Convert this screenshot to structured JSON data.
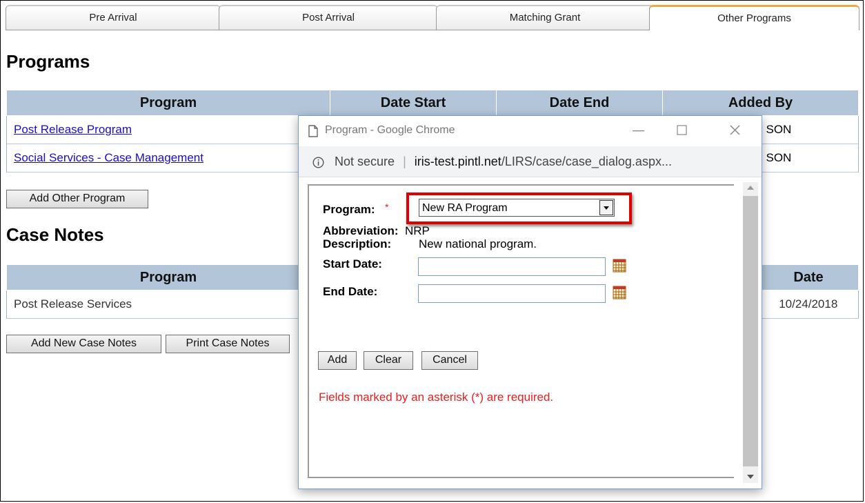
{
  "tabs": [
    "Pre Arrival",
    "Post Arrival",
    "Matching Grant",
    "Other Programs"
  ],
  "programs": {
    "heading": "Programs",
    "columns": [
      "Program",
      "Date Start",
      "Date End",
      "Added By"
    ],
    "rows": [
      {
        "program": "Post Release Program",
        "added_by": "SON"
      },
      {
        "program": "Social Services - Case Management",
        "added_by": "SON"
      }
    ],
    "add_button": "Add Other Program"
  },
  "case_notes": {
    "heading": "Case Notes",
    "columns": [
      "Program",
      "Date"
    ],
    "rows": [
      {
        "program": "Post Release Services",
        "date": "10/24/2018"
      }
    ],
    "add_button": "Add New Case Notes",
    "print_button": "Print Case Notes"
  },
  "popup": {
    "window_title": "Program - Google Chrome",
    "security": "Not secure",
    "url_host": "iris-test.pintl.net",
    "url_path": "/LIRS/case/case_dialog.aspx...",
    "program_label": "Program:",
    "required_mark": "*",
    "program_selected": "New RA Program",
    "abbreviation_label": "Abbreviation:",
    "abbreviation_value": "NRP",
    "description_label": "Description:",
    "description_value": "New national program.",
    "start_date_label": "Start Date:",
    "end_date_label": "End Date:",
    "start_date_value": "",
    "end_date_value": "",
    "add_label": "Add",
    "clear_label": "Clear",
    "cancel_label": "Cancel",
    "required_note": "Fields marked by an asterisk (*) are required."
  },
  "colors": {
    "header_bg": "#b3c6d9",
    "active_tab_accent": "#f2a93b",
    "highlight": "#e00000",
    "required_text": "#e8201f"
  }
}
